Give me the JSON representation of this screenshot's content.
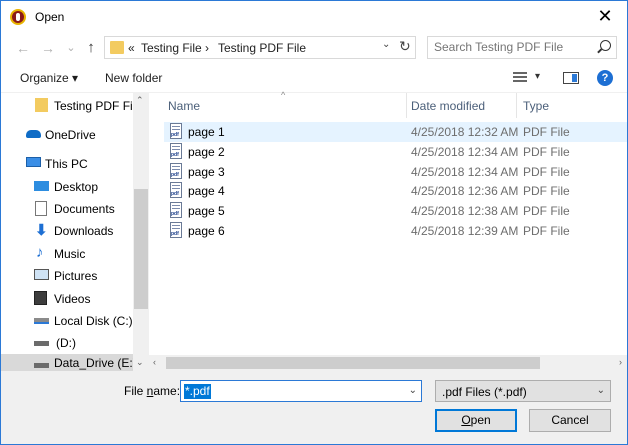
{
  "window": {
    "title": "Open",
    "close_glyph": "✕"
  },
  "navigation": {
    "back_glyph": "←",
    "forward_glyph": "→",
    "recent_glyph": "⌄",
    "up_glyph": "↑",
    "breadcrumb_prefix": "«",
    "breadcrumb": [
      "Testing File",
      "Testing PDF File"
    ],
    "breadcrumb_sep": "›",
    "dropdown_glyph": "⌄",
    "refresh_glyph": "↻",
    "search_placeholder": "Search Testing PDF File"
  },
  "toolbar": {
    "organize_label": "Organize ▾",
    "new_folder_label": "New folder",
    "view_dropdown_glyph": "▾",
    "help_glyph": "?"
  },
  "nav_pane": {
    "items": [
      {
        "label": "Testing PDF File",
        "icon": "folder-icon"
      },
      {
        "label": "OneDrive",
        "icon": "onedrive-icon"
      },
      {
        "label": "This PC",
        "icon": "computer-icon"
      },
      {
        "label": "Desktop",
        "icon": "desktop-icon"
      },
      {
        "label": "Documents",
        "icon": "documents-icon"
      },
      {
        "label": "Downloads",
        "icon": "downloads-icon"
      },
      {
        "label": "Music",
        "icon": "music-icon"
      },
      {
        "label": "Pictures",
        "icon": "pictures-icon"
      },
      {
        "label": "Videos",
        "icon": "videos-icon"
      },
      {
        "label": "Local Disk (C:)",
        "icon": "local-disk-icon"
      },
      {
        "label": "(D:)",
        "icon": "drive-icon"
      },
      {
        "label": "Data_Drive (E:)",
        "icon": "drive-icon"
      }
    ],
    "scroll_up_glyph": "⌃",
    "scroll_down_glyph": "⌄"
  },
  "file_list": {
    "columns": {
      "name": "Name",
      "date": "Date modified",
      "type": "Type"
    },
    "sort_glyph": "^",
    "rows": [
      {
        "name": "page 1",
        "date": "4/25/2018 12:32 AM",
        "type": "PDF File"
      },
      {
        "name": "page 2",
        "date": "4/25/2018 12:34 AM",
        "type": "PDF File"
      },
      {
        "name": "page 3",
        "date": "4/25/2018 12:34 AM",
        "type": "PDF File"
      },
      {
        "name": "page 4",
        "date": "4/25/2018 12:36 AM",
        "type": "PDF File"
      },
      {
        "name": "page 5",
        "date": "4/25/2018 12:38 AM",
        "type": "PDF File"
      },
      {
        "name": "page 6",
        "date": "4/25/2018 12:39 AM",
        "type": "PDF File"
      }
    ],
    "hscroll_left_glyph": "‹",
    "hscroll_right_glyph": "›"
  },
  "footer": {
    "file_name_label_pre": "File ",
    "file_name_label_accel": "n",
    "file_name_label_post": "ame:",
    "file_name_value": "*.pdf",
    "file_type_value": ".pdf Files (*.pdf)",
    "dropdown_glyph": "⌄",
    "open_accel": "O",
    "open_rest": "pen",
    "cancel_label": "Cancel"
  },
  "colors": {
    "accent": "#0078d7",
    "window_border": "#2b79d6",
    "hover_row": "#e5f3ff",
    "selected_nav": "#d9d9d9"
  }
}
